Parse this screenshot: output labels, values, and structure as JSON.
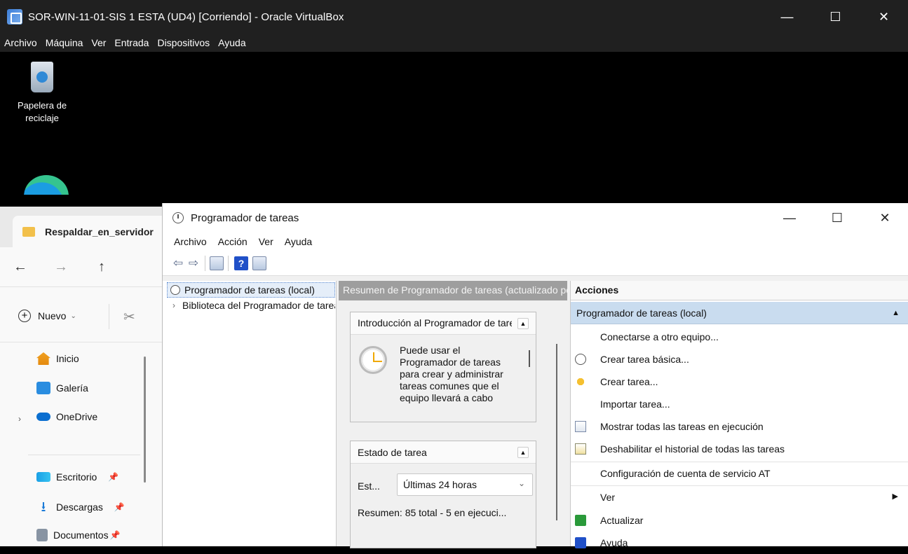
{
  "vbox": {
    "title": "SOR-WIN-11-01-SIS 1  ESTA (UD4) [Corriendo] - Oracle VirtualBox",
    "menu": [
      "Archivo",
      "Máquina",
      "Ver",
      "Entrada",
      "Dispositivos",
      "Ayuda"
    ],
    "controls": {
      "minimize": "—",
      "maximize": "☐",
      "close": "✕"
    }
  },
  "desktop": {
    "recycle_bin_line1": "Papelera de",
    "recycle_bin_line2": "reciclaje"
  },
  "explorer": {
    "tab_title": "Respaldar_en_servidor",
    "nav": {
      "back": "←",
      "forward": "→",
      "up": "↑"
    },
    "new_label": "Nuevo",
    "sidebar": [
      {
        "label": "Inicio"
      },
      {
        "label": "Galería"
      },
      {
        "label": "OneDrive"
      },
      {
        "label": "Escritorio"
      },
      {
        "label": "Descargas"
      },
      {
        "label": "Documentos"
      }
    ]
  },
  "scheduler": {
    "title": "Programador de tareas",
    "controls": {
      "minimize": "—",
      "maximize": "☐",
      "close": "✕"
    },
    "menu": [
      "Archivo",
      "Acción",
      "Ver",
      "Ayuda"
    ],
    "tree": {
      "root": "Programador de tareas (local)",
      "library": "Biblioteca del Programador de tareas"
    },
    "summary": {
      "header": "Resumen de Programador de tareas (actualizado por última vez)",
      "intro": {
        "title": "Introducción al Programador de tareas",
        "text": "Puede usar el Programador de tareas para crear y administrar tareas comunes que el equipo llevará a cabo"
      },
      "status": {
        "title": "Estado de tarea",
        "label": "Est...",
        "selected": "Últimas 24 horas",
        "summary": "Resumen: 85 total - 5 en ejecuci..."
      }
    },
    "actions": {
      "header": "Acciones",
      "group": "Programador de tareas (local)",
      "items": [
        {
          "label": "Conectarse a otro equipo...",
          "icon": "none"
        },
        {
          "label": "Crear tarea básica...",
          "icon": "clock-icon"
        },
        {
          "label": "Crear tarea...",
          "icon": "task-icon"
        },
        {
          "label": "Importar tarea...",
          "icon": "none"
        },
        {
          "label": "Mostrar todas las tareas en ejecución",
          "icon": "running-tasks-icon"
        },
        {
          "label": "Deshabilitar el historial de todas las tareas",
          "icon": "history-icon"
        },
        {
          "label": "Configuración de cuenta de servicio AT",
          "icon": "none"
        },
        {
          "label": "Ver",
          "icon": "none"
        },
        {
          "label": "Actualizar",
          "icon": "refresh-icon"
        },
        {
          "label": "Ayuda",
          "icon": "help-icon"
        }
      ]
    }
  }
}
